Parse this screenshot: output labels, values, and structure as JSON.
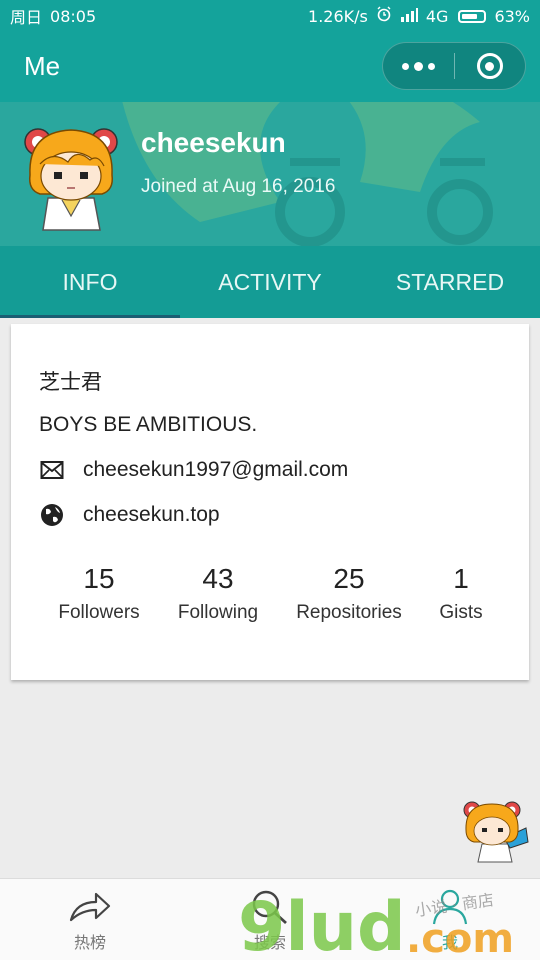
{
  "status_bar": {
    "day": "周日",
    "time": "08:05",
    "speed": "1.26K/s",
    "network": "4G",
    "battery": "63%"
  },
  "app_bar": {
    "title": "Me"
  },
  "profile": {
    "username": "cheesekun",
    "joined": "Joined at Aug 16, 2016"
  },
  "tabs": [
    {
      "label": "INFO",
      "active": true
    },
    {
      "label": "ACTIVITY",
      "active": false
    },
    {
      "label": "STARRED",
      "active": false
    }
  ],
  "info": {
    "name": "芝士君",
    "bio": "BOYS BE AMBITIOUS.",
    "email": "cheesekun1997@gmail.com",
    "website": "cheesekun.top"
  },
  "stats": [
    {
      "value": "15",
      "label": "Followers"
    },
    {
      "value": "43",
      "label": "Following"
    },
    {
      "value": "25",
      "label": "Repositories"
    },
    {
      "value": "1",
      "label": "Gists"
    }
  ],
  "bottom_nav": [
    {
      "label": "热榜",
      "icon": "share-arrow-icon"
    },
    {
      "label": "搜索",
      "icon": "search-icon"
    },
    {
      "label": "我",
      "icon": "person-icon"
    }
  ],
  "watermark": {
    "brand": "9lud",
    "tld": ".com",
    "script_text": "小说 · 商店"
  },
  "colors": {
    "primary": "#14a39b",
    "header_bg": "#2aa79e",
    "tab_indicator": "#1b5e73",
    "page_bg": "#ececec"
  }
}
